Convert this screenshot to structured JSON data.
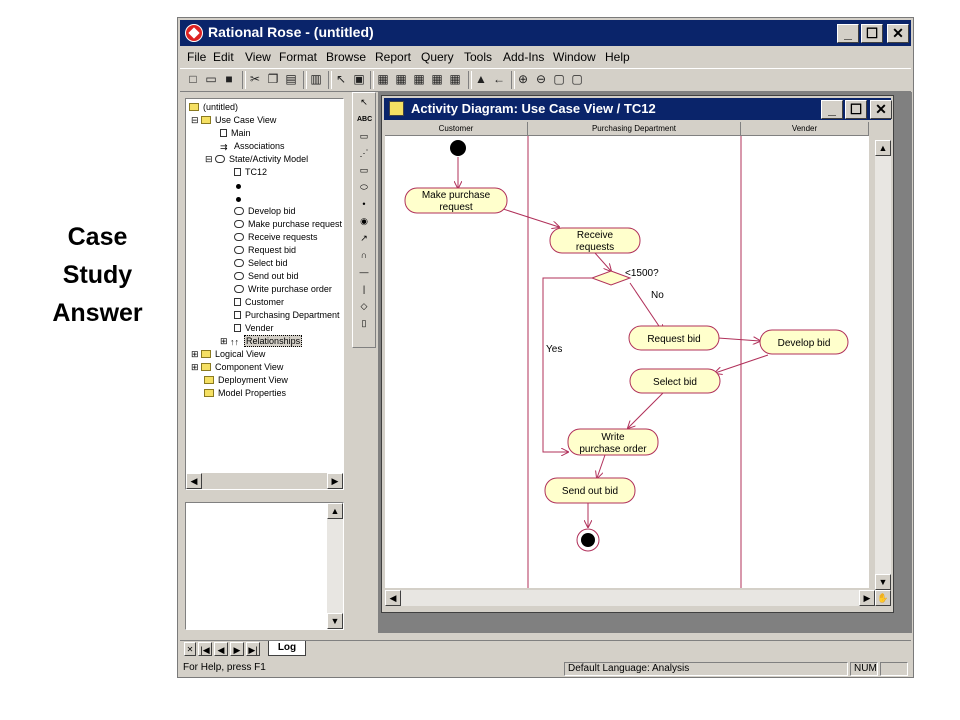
{
  "slide": {
    "label_line1": "Case",
    "label_line2": "Study",
    "label_line3": "Answer"
  },
  "app": {
    "title": "Rational Rose - (untitled)",
    "menu": [
      "File",
      "Edit",
      "View",
      "Format",
      "Browse",
      "Report",
      "Query",
      "Tools",
      "Add-Ins",
      "Window",
      "Help"
    ],
    "win_min": "_",
    "win_max": "☐",
    "win_close": "✕"
  },
  "browser": {
    "root": "(untitled)",
    "use_case_view": "Use Case View",
    "main": "Main",
    "associations": "Associations",
    "state_model": "State/Activity Model",
    "tc12": "TC12",
    "activities": [
      "Develop bid",
      "Make purchase request",
      "Receive requests",
      "Request bid",
      "Select bid",
      "Send out bid",
      "Write purchase order"
    ],
    "swimlanes": [
      "Customer",
      "Purchasing Department",
      "Vender"
    ],
    "relationships": "Relationships",
    "logical_view": "Logical View",
    "component_view": "Component View",
    "deployment_view": "Deployment View",
    "model_properties": "Model Properties"
  },
  "diagram": {
    "title": "Activity Diagram: Use Case View / TC12",
    "lanes": [
      "Customer",
      "Purchasing Department",
      "Vender"
    ],
    "nodes": {
      "make_line1": "Make purchase",
      "make_line2": "request",
      "receive_line1": "Receive",
      "receive_line2": "requests",
      "request_bid": "Request bid",
      "develop_bid": "Develop bid",
      "select_bid": "Select bid",
      "write_line1": "Write",
      "write_line2": "purchase order",
      "send_out_bid": "Send out bid"
    },
    "guards": {
      "condition": "<1500?",
      "no": "No",
      "yes": "Yes"
    },
    "colors": {
      "activity_fill": "#ffffcc",
      "line": "#b0305a"
    }
  },
  "log": {
    "tab": "Log"
  },
  "status": {
    "help": "For Help, press F1",
    "language": "Default Language: Analysis",
    "num": "NUM"
  }
}
